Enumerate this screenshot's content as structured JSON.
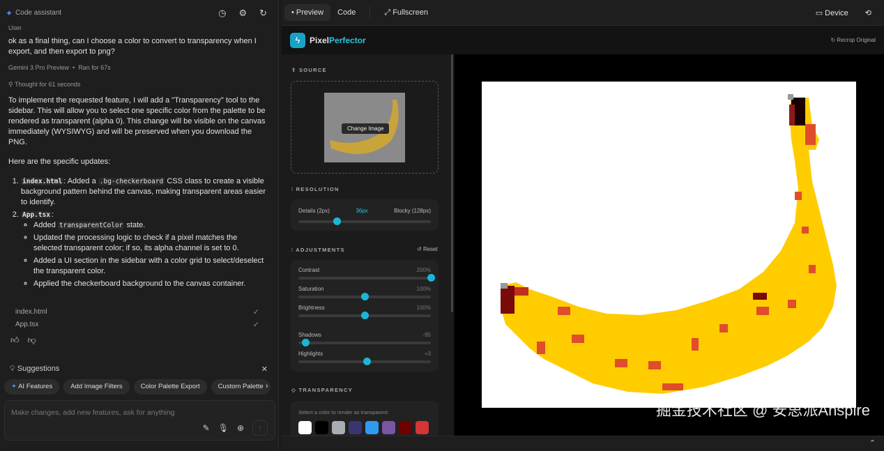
{
  "left": {
    "title": "Code assistant",
    "user_label": "User",
    "user_message": "ok as a final thing, can I choose a color to convert to transparency when I export, and then export to png?",
    "model": "Gemini 3 Pro Preview",
    "ran_for": "Ran for 67s",
    "thought": "Thought for 61 seconds",
    "intro": "To implement the requested feature, I will add a \"Transparency\" tool to the sidebar. This will allow you to select one specific color from the palette to be rendered as transparent (alpha 0). This change will be visible on the canvas immediately (WYSIWYG) and will be preserved when you download the PNG.",
    "updates_heading": "Here are the specific updates:",
    "item1_code": "index.html",
    "item1_a": ": Added a ",
    "item1_code2": ".bg-checkerboard",
    "item1_b": " CSS class to create a visible background pattern behind the canvas, making transparent areas easier to identify.",
    "item2_code": "App.tsx",
    "item2_colon": ":",
    "sub1_a": "Added ",
    "sub1_code": "transparentColor",
    "sub1_b": " state.",
    "sub2": "Updated the processing logic to check if a pixel matches the selected transparent color; if so, its alpha channel is set to 0.",
    "sub3": "Added a UI section in the sidebar with a color grid to select/deselect the transparent color.",
    "sub4": "Applied the checkerboard background to the canvas container.",
    "files": [
      "index.html",
      "App.tsx"
    ],
    "suggestions_title": "Suggestions",
    "chips": [
      "AI Features",
      "Add Image Filters",
      "Color Palette Export",
      "Custom Palette"
    ],
    "input_placeholder": "Make changes, add new features, ask for anything"
  },
  "right": {
    "tabs": [
      "Preview",
      "Code"
    ],
    "fullscreen": "Fullscreen",
    "device": "Device",
    "app": {
      "brand_a": "Pixel",
      "brand_b": "Perfector",
      "recrop": "Recrop Original",
      "source": "SOURCE",
      "change_image": "Change Image",
      "resolution": "RESOLUTION",
      "res_min": "Details (2px)",
      "res_value": "36px",
      "res_max": "Blocky (128px)",
      "res_fraction": 0.29,
      "adjustments": "ADJUSTMENTS",
      "reset": "Reset",
      "sliders": [
        {
          "label": "Contrast",
          "value": "200%",
          "fraction": 1.0
        },
        {
          "label": "Saturation",
          "value": "100%",
          "fraction": 0.5
        },
        {
          "label": "Brightness",
          "value": "100%",
          "fraction": 0.5
        },
        {
          "label": "Shadows",
          "value": "-95",
          "fraction": 0.05
        },
        {
          "label": "Highlights",
          "value": "+3",
          "fraction": 0.515
        }
      ],
      "transparency": "TRANSPARENCY",
      "transparency_hint": "Select a color to render as transparent:",
      "swatches": [
        "#ffffff",
        "#000000",
        "#a7adb2",
        "#3a3470",
        "#2f9bf0",
        "#7a55a3",
        "#6e0000",
        "#d43535"
      ]
    }
  },
  "watermark": "掘金技术社区 @ 安思派Anspire"
}
